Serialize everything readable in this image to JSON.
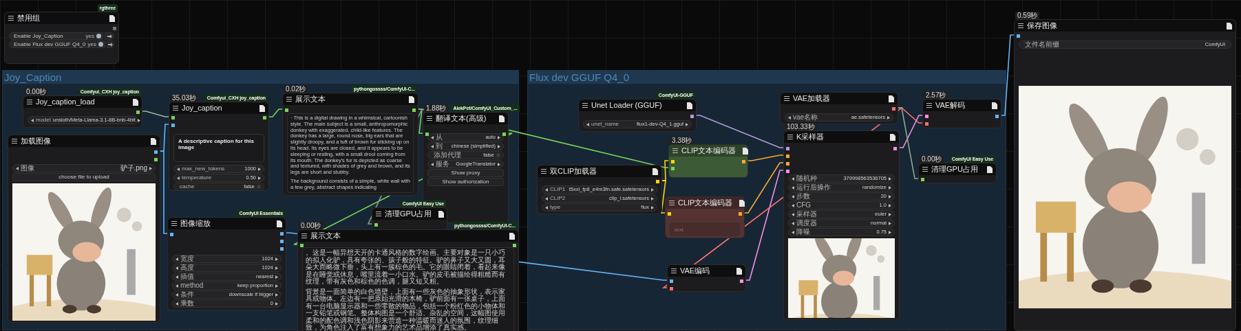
{
  "groups": [
    {
      "title": "Joy_Caption"
    },
    {
      "title": "Flux dev GGUF Q4_0"
    }
  ],
  "nodes": [
    {
      "title": "禁用组",
      "source": "rgthree",
      "widgets": [
        {
          "kind": "group_toggle",
          "label": "Enable Joy_Caption",
          "value": "yes",
          "on": true
        },
        {
          "kind": "group_toggle",
          "label": "Enable Flux dev GGUF Q4_0",
          "value": "yes",
          "on": true
        }
      ]
    },
    {
      "title": "Joy_caption_load",
      "time": "0.00秒",
      "source": "Comfyui_CXH joy_caption",
      "widgets": [
        {
          "kind": "combo",
          "label": "model",
          "value": "unsloth/Meta-Llama-3.1-8B-bnb-4bit"
        }
      ]
    },
    {
      "title": "加载图像",
      "widgets": [
        {
          "kind": "combo",
          "label": "图像",
          "value": "驴子.png"
        },
        {
          "kind": "button",
          "label": "choose file to upload"
        }
      ],
      "image": {
        "kind": "picture"
      }
    },
    {
      "title": "Joy_caption",
      "time": "35.03秒",
      "source": "Comfyui_CXH joy_caption",
      "textarea": {
        "value": "A descriptive caption for this image"
      },
      "widgets": [
        {
          "kind": "combo",
          "label": "max_new_tokens",
          "value": "1000"
        },
        {
          "kind": "combo",
          "label": "temperature",
          "value": "0.50"
        },
        {
          "kind": "toggle",
          "label": "cache",
          "value": "false",
          "on": false
        }
      ]
    },
    {
      "title": "展示文本",
      "time": "0.02秒",
      "source": "pythongossss/ComfyUI-C...",
      "display": [
        "· This is a digital drawing in a whimsical, cartoonish style. The main subject is a small, anthropomorphic donkey with exaggerated, child-like features. The donkey has a large, round nose, big ears that are slightly droopy, and a tuft of brown fur sticking up on its head. Its eyes are closed, and it appears to be sleeping or resting, with a small drool coming from its mouth. The donkey's fur is depicted as coarse and textured, with shades of grey and brown, and its legs are short and stubby.",
        "The background consists of a simple, white wall with a few grey, abstract shapes indicating"
      ]
    },
    {
      "title": "翻译文本(高级)",
      "time": "1.88秒",
      "source": "AlekPet/ComfyUI_Custom_...",
      "widgets": [
        {
          "kind": "combo",
          "label": "从",
          "value": "auto"
        },
        {
          "kind": "combo",
          "label": "到",
          "value": "chinese (simplified)"
        },
        {
          "kind": "toggle",
          "label": "添加代理",
          "value": "false",
          "on": false
        },
        {
          "kind": "combo",
          "label": "服务",
          "value": "GoogleTranslator"
        },
        {
          "kind": "button",
          "label": "Show proxy"
        },
        {
          "kind": "button",
          "label": "Show authorization"
        }
      ]
    },
    {
      "title": "图像缩放",
      "source": "ComfyUI Essentials",
      "widgets": [
        {
          "kind": "combo",
          "label": "宽度",
          "value": "1024"
        },
        {
          "kind": "combo",
          "label": "高度",
          "value": "1024"
        },
        {
          "kind": "combo",
          "label": "插值",
          "value": "nearest"
        },
        {
          "kind": "combo",
          "label": "method",
          "value": "keep proportion"
        },
        {
          "kind": "combo",
          "label": "条件",
          "value": "downscale if bigger"
        },
        {
          "kind": "combo",
          "label": "乘数",
          "value": "0"
        }
      ]
    },
    {
      "title": "清理GPU占用",
      "source": "ComfyUI Easy Use"
    },
    {
      "title": "展示文本",
      "time": "0.00秒",
      "source": "pythongossss/ComfyUI-C...",
      "display": [
        "。这是一幅异想天开的卡通风格的数字绘画。主要对象是一只小巧的拟人化驴，具有夸张的、孩子般的特征。驴的鼻子又大又圆，耳朵大而略微下垂，头上有一簇棕色的毛。它的眼睛闭着，看起来像是在睡觉或休息，嘴里流着一小口水。驴的皮毛被描绘得粗糙而有纹理，带有灰色和棕色的色调，腿又短又粗。",
        "背景是一面简单的白色墙壁，上面有一些灰色的抽象形状，表示家具或物体。左边有一把原始光滑的木椅，驴前面有一张桌子，上面有一台电脑显示器和一些零散的物品，包括一个粉红色的小物体和一支铅笔或钢笔。整体构图是一个舒适、杂乱的空间，这幅图使用柔和的配色调和浅色阴影来营造一种温暖而迷人的氛围，纹理细致，为角色注入了富有想象力的艺术品增添了真实感。"
      ]
    },
    {
      "title": "Unet Loader (GGUF)",
      "source": "ComfyUI-GGUF",
      "widgets": [
        {
          "kind": "combo",
          "label": "unet_name",
          "value": "flux1-dev-Q4_1.gguf"
        }
      ]
    },
    {
      "title": "双CLIP加载器",
      "widgets": [
        {
          "kind": "combo",
          "label": "CLIP1",
          "value": "t5xxl_fp8_e4m3fn.safe.safetensors"
        },
        {
          "kind": "combo",
          "label": "CLIP2",
          "value": "clip_l.safetensors"
        },
        {
          "kind": "combo",
          "label": "type",
          "value": "flux"
        }
      ]
    },
    {
      "title": "CLIP文本编码器",
      "time": "3.38秒",
      "color": "#3d5a36"
    },
    {
      "title": "CLIP文本编码器",
      "color": "#553333",
      "textarea": {
        "placeholder": "text"
      }
    },
    {
      "title": "VAE编码"
    },
    {
      "title": "VAE加载器",
      "widgets": [
        {
          "kind": "combo",
          "label": "vae名称",
          "value": "ae.safetensors"
        }
      ]
    },
    {
      "title": "K采样器",
      "time": "103.33秒",
      "widgets": [
        {
          "kind": "combo",
          "label": "随机种",
          "value": "379998563536705"
        },
        {
          "kind": "combo",
          "label": "运行后操作",
          "value": "randomize"
        },
        {
          "kind": "combo",
          "label": "步数",
          "value": "20"
        },
        {
          "kind": "combo",
          "label": "CFG",
          "value": "1.0"
        },
        {
          "kind": "combo",
          "label": "采样器",
          "value": "euler"
        },
        {
          "kind": "combo",
          "label": "调度器",
          "value": "normal"
        },
        {
          "kind": "combo",
          "label": "降噪",
          "value": "0.75"
        }
      ],
      "image": {
        "kind": "picture"
      }
    },
    {
      "title": "VAE解码",
      "time": "2.57秒"
    },
    {
      "title": "清理GPU占用",
      "time": "0.00秒",
      "source": "ComfyUI Easy Use"
    },
    {
      "title": "保存图像",
      "time": "0.59秒",
      "widgets": [
        {
          "kind": "string",
          "label": "文件名前缀",
          "value": "ComfyUI"
        }
      ],
      "image": {
        "kind": "picture"
      }
    }
  ]
}
